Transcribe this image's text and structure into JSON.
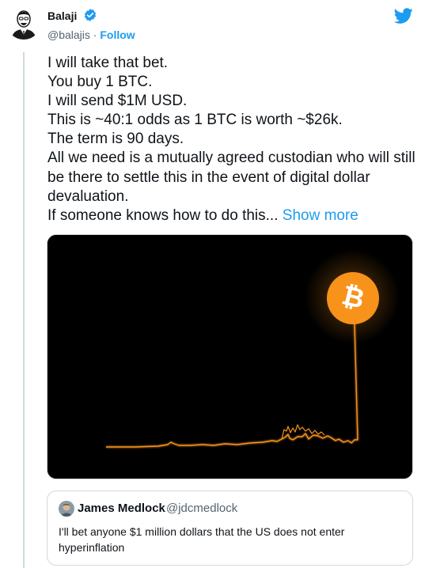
{
  "author": {
    "name": "Balaji",
    "handle": "@balajis",
    "separator": " · ",
    "follow_label": "Follow"
  },
  "brand": {
    "twitter_color": "#1d9bf0",
    "verified_color": "#1d9bf0",
    "bitcoin_color": "#f7931a"
  },
  "tweet": {
    "lines": [
      "I will take that bet.",
      "You buy 1 BTC.",
      "I will send $1M USD.",
      "This is ~40:1 odds as 1 BTC is worth ~$26k.",
      "The term is 90 days.",
      "All we need is a mutually agreed custodian who will still be there to settle this in the event of digital dollar devaluation."
    ],
    "last_line": "If someone knows how to do this...",
    "show_more_label": "Show more"
  },
  "media": {
    "icon": "bitcoin-icon",
    "description_icon": "price-chart-line"
  },
  "quoted_tweet": {
    "name": "James Medlock",
    "handle": "@jdcmedlock",
    "text": "I'll bet anyone $1 million dollars that the US does not enter hyperinflation"
  }
}
